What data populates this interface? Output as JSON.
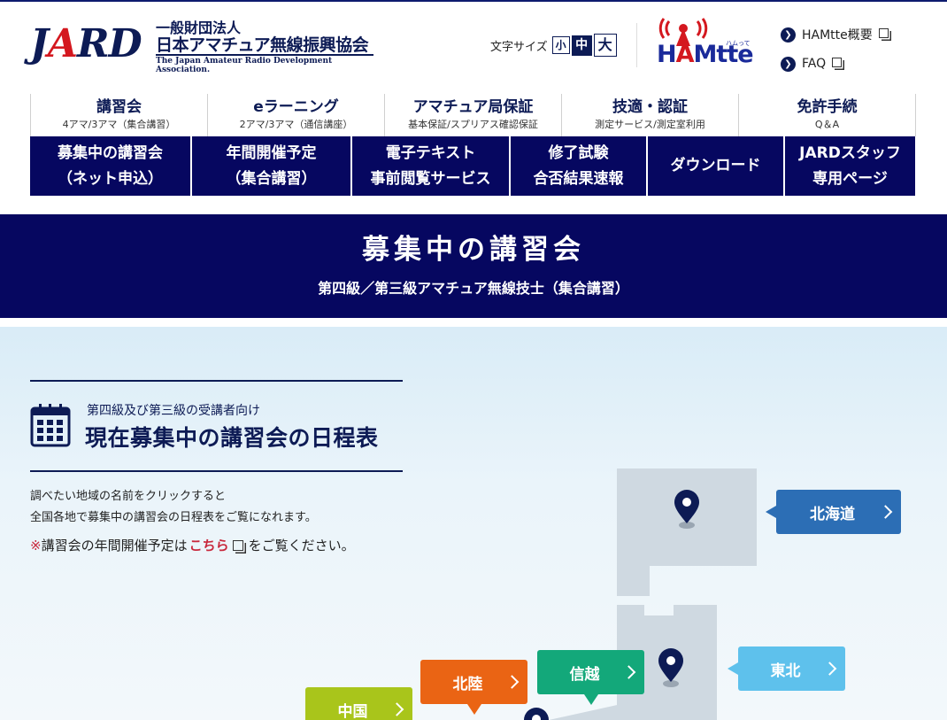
{
  "header": {
    "logo": {
      "jard": "JARD",
      "org_line1": "一般財団法人",
      "org_line2": "日本アマチュア無線振興協会",
      "org_english": "The Japan Amateur Radio Development Association."
    },
    "font_size": {
      "label": "文字サイズ",
      "small": "小",
      "medium": "中",
      "large": "大",
      "selected": "中"
    },
    "hamtte": {
      "text": "HAMtte",
      "kana": "ハムって"
    },
    "links": [
      {
        "label": "HAMtte概要"
      },
      {
        "label": "FAQ"
      }
    ]
  },
  "main_nav": [
    {
      "title": "講習会",
      "sub": "4アマ/3アマ（集合講習）"
    },
    {
      "title": "eラーニング",
      "sub": "2アマ/3アマ（通信講座）"
    },
    {
      "title": "アマチュア局保証",
      "sub": "基本保証/スプリアス確認保証"
    },
    {
      "title": "技適・認証",
      "sub": "測定サービス/測定室利用"
    },
    {
      "title": "免許手続",
      "sub": "Q＆A"
    }
  ],
  "sub_nav": [
    {
      "line1": "募集中の講習会",
      "line2": "（ネット申込）"
    },
    {
      "line1": "年間開催予定",
      "line2": "（集合講習）"
    },
    {
      "line1": "電子テキスト",
      "line2": "事前閲覧サービス"
    },
    {
      "line1": "修了試験",
      "line2": "合否結果速報"
    },
    {
      "line1": "ダウンロード",
      "line2": ""
    },
    {
      "line1": "JARDスタッフ",
      "line2": "専用ページ"
    }
  ],
  "page_title": {
    "title": "募集中の講習会",
    "subtitle": "第四級／第三級アマチュア無線技士（集合講習）"
  },
  "schedule": {
    "sub": "第四級及び第三級の受講者向け",
    "title": "現在募集中の講習会の日程表",
    "desc_line1": "調べたい地域の名前をクリックすると",
    "desc_line2": "全国各地で募集中の講習会の日程表をご覧になれます。",
    "note_mark": "※",
    "note_before": "講習会の年間開催予定は",
    "note_link": "こちら",
    "note_after": "をご覧ください。"
  },
  "regions": [
    {
      "name": "北海道",
      "color": "#2c6eb5"
    },
    {
      "name": "東北",
      "color": "#5ec1ec"
    },
    {
      "name": "信越",
      "color": "#13a87a"
    },
    {
      "name": "北陸",
      "color": "#ea6414"
    },
    {
      "name": "中国",
      "color": "#a9c51b"
    }
  ],
  "colors": {
    "navy": "#060760",
    "brand_navy": "#0d1b55",
    "accent_red": "#c8283c",
    "map_land": "#cfd9e1"
  },
  "icons": {
    "calendar": "calendar-icon",
    "pin": "map-pin-icon",
    "arrow": "chevron-right-icon",
    "external": "external-window-icon"
  }
}
